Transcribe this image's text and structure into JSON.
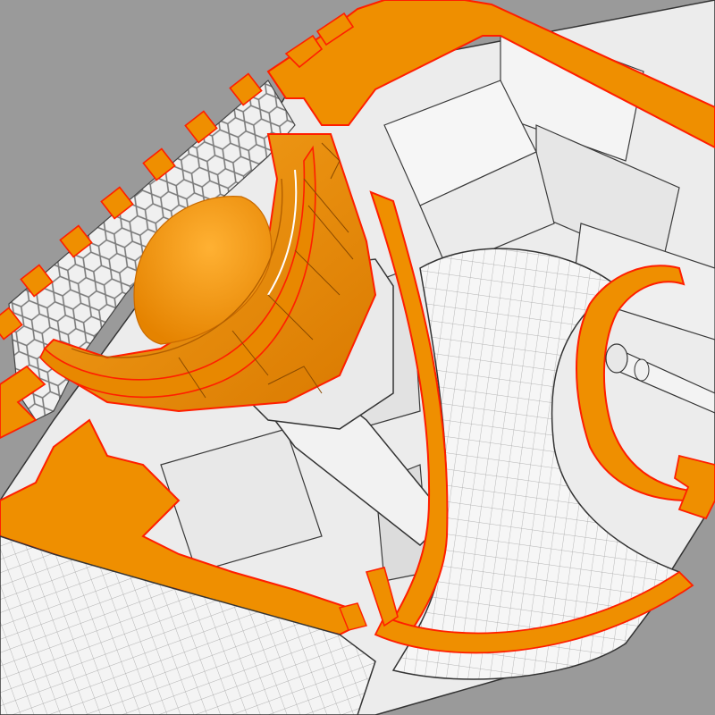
{
  "view": {
    "background_color": "#9a9a9a",
    "section_fill_color": "#ef8f00",
    "section_edge_color": "#ff1e00",
    "surface_color": "#f2f2f2",
    "mesh_line_color": "#8a8a8a",
    "outline_color": "#2a2a2a"
  }
}
